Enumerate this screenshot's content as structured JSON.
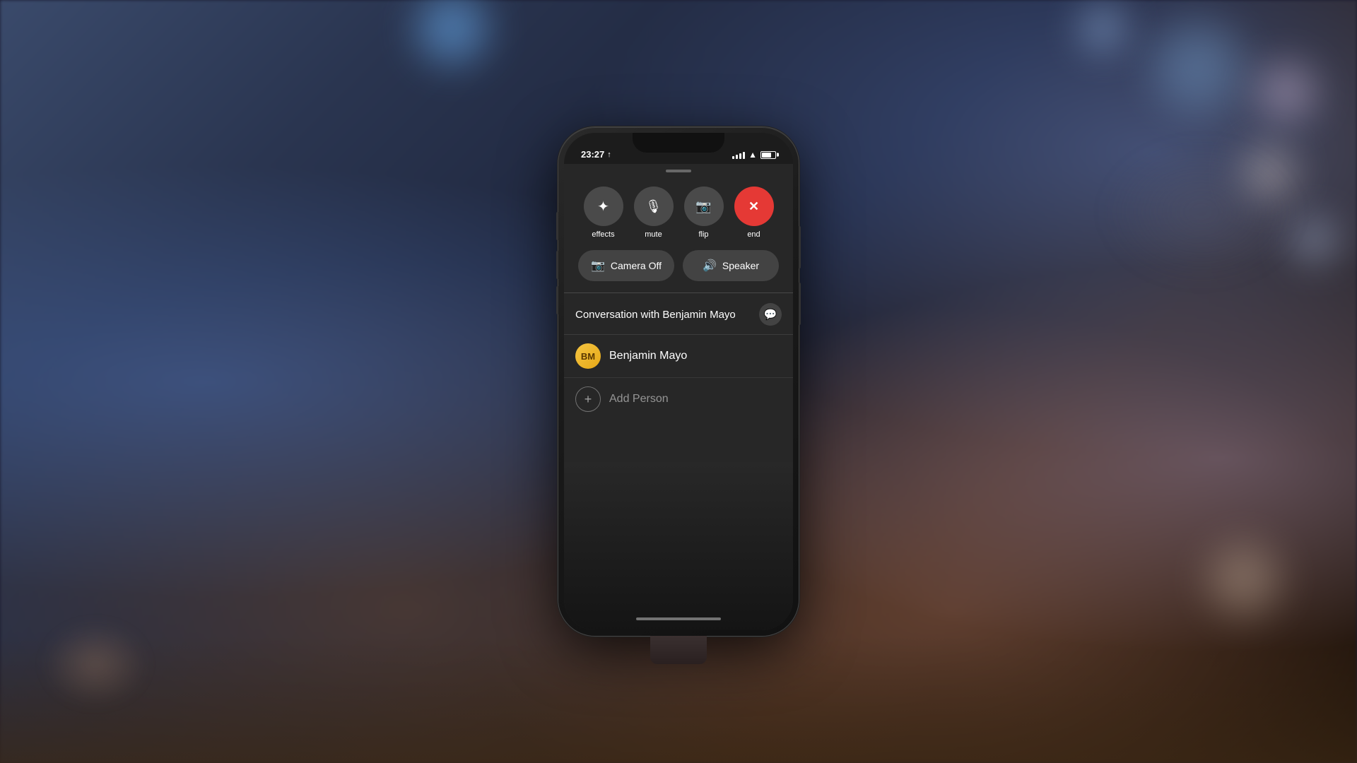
{
  "background": {
    "description": "Blurred bokeh background with blue and warm tones"
  },
  "status_bar": {
    "time": "23:27",
    "location_arrow": "↑",
    "wifi": "wifi",
    "battery": "battery"
  },
  "call_controls": {
    "buttons": [
      {
        "id": "effects",
        "label": "effects",
        "icon": "✦",
        "type": "normal"
      },
      {
        "id": "mute",
        "label": "mute",
        "icon": "🎤",
        "type": "normal"
      },
      {
        "id": "flip",
        "label": "flip",
        "icon": "📷",
        "type": "normal"
      },
      {
        "id": "end",
        "label": "end",
        "icon": "✕",
        "type": "end"
      }
    ],
    "wide_buttons": [
      {
        "id": "camera_off",
        "label": "Camera Off",
        "icon": "📷"
      },
      {
        "id": "speaker",
        "label": "Speaker",
        "icon": "🔊"
      }
    ]
  },
  "conversation": {
    "title": "Conversation with Benjamin Mayo",
    "message_icon": "💬",
    "participant": {
      "initials": "BM",
      "name": "Benjamin Mayo"
    },
    "add_person_label": "Add Person"
  },
  "home_indicator": true
}
